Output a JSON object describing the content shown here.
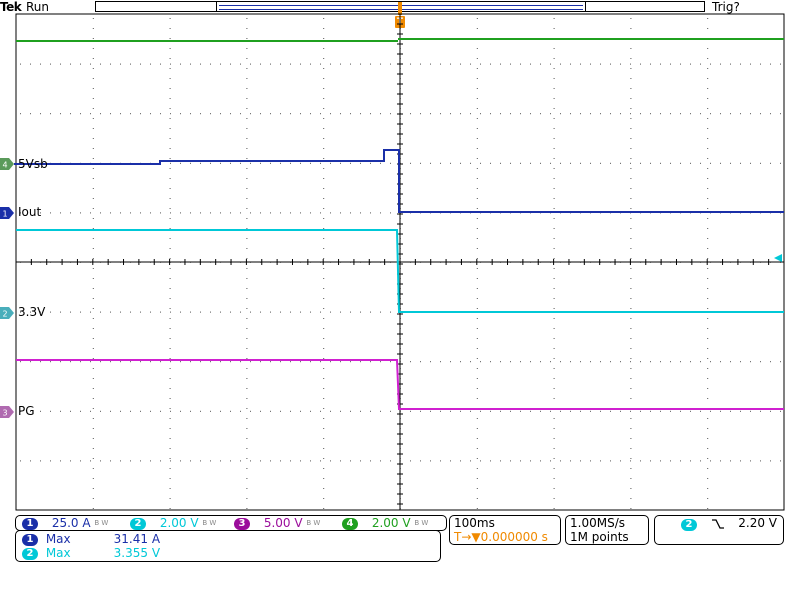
{
  "header": {
    "brand": "Tek",
    "run_state": "Run",
    "trigger_state": "Trig?",
    "trigger_marker": "T"
  },
  "colors": {
    "ch1": "#1a2fa8",
    "ch2": "#00c8d7",
    "ch3": "#9b0d9b",
    "ch4": "#1fa01f",
    "ref_green": "#5a9a5a",
    "ref_pink": "#b06ab0",
    "trigger": "#f08a00"
  },
  "channel_labels": {
    "ref_5vsb": "5Vsb",
    "iout": "Iout",
    "v3v3": "3.3V",
    "pg": "PG"
  },
  "scales": [
    {
      "num": "1",
      "value": "25.0 A"
    },
    {
      "num": "2",
      "value": "2.00 V"
    },
    {
      "num": "3",
      "value": "5.00 V"
    },
    {
      "num": "4",
      "value": "2.00 V"
    }
  ],
  "measurements": [
    {
      "num": "1",
      "name": "Max",
      "value": "31.41 A"
    },
    {
      "num": "2",
      "name": "Max",
      "value": "3.355 V"
    }
  ],
  "timebase": {
    "per_div": "100ms",
    "trigger_pos": "T→▼0.000000 s"
  },
  "acquisition": {
    "sample_rate": "1.00MS/s",
    "record_length": "1M points"
  },
  "trigger": {
    "source": "2",
    "slope": "falling",
    "level": "2.20 V"
  }
}
